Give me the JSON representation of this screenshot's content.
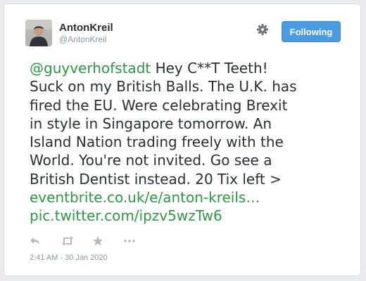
{
  "user": {
    "display_name": "AntonKreil",
    "handle": "@AntonKreil"
  },
  "settings_icon": "gear-icon",
  "follow_button": {
    "label": "Following",
    "color": "#4a9be0"
  },
  "tweet": {
    "mention": "@guyverhofstadt",
    "line1_rest": " Hey C**T Teeth!",
    "line2": "Suck on my British Balls. The U.K. has",
    "line3": "fired the EU. Were celebrating Brexit",
    "line4": "in style in Singapore tomorrow. An",
    "line5": "Island Nation trading freely with the",
    "line6": "World. You're not invited. Go see a",
    "line7": "British Dentist instead. 20 Tix left >",
    "link1": "eventbrite.co.uk/e/anton-kreils…",
    "link2": "pic.twitter.com/ipzv5wzTw6",
    "link_color": "#2b9940"
  },
  "actions": [
    "reply-icon",
    "retweet-icon",
    "favorite-icon",
    "more-icon"
  ],
  "timestamp": "2:41 AM - 30 Jan 2020"
}
